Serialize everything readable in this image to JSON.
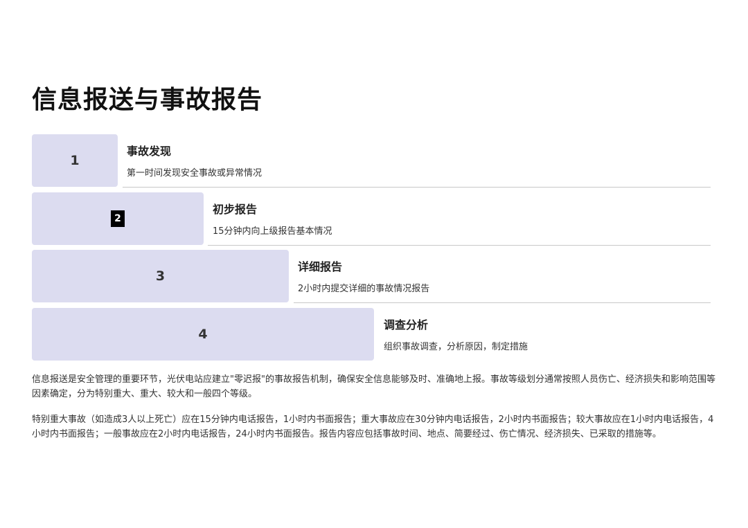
{
  "title": "信息报送与事故报告",
  "steps": [
    {
      "num": "1",
      "title": "事故发现",
      "desc": "第一时间发现安全事故或异常情况"
    },
    {
      "num": "2",
      "title": "初步报告",
      "desc": "15分钟内向上级报告基本情况"
    },
    {
      "num": "3",
      "title": "详细报告",
      "desc": "2小时内提交详细的事故情况报告"
    },
    {
      "num": "4",
      "title": "调查分析",
      "desc": "组织事故调查，分析原因，制定措施"
    }
  ],
  "paragraphs": [
    "信息报送是安全管理的重要环节，光伏电站应建立\"零迟报\"的事故报告机制，确保安全信息能够及时、准确地上报。事故等级划分通常按照人员伤亡、经济损失和影响范围等因素确定，分为特别重大、重大、较大和一般四个等级。",
    "特别重大事故（如造成3人以上死亡）应在15分钟内电话报告，1小时内书面报告；重大事故应在30分钟内电话报告，2小时内书面报告；较大事故应在1小时内电话报告，4小时内书面报告；一般事故应在2小时内电话报告，24小时内书面报告。报告内容应包括事故时间、地点、简要经过、伤亡情况、经济损失、已采取的措施等。"
  ]
}
